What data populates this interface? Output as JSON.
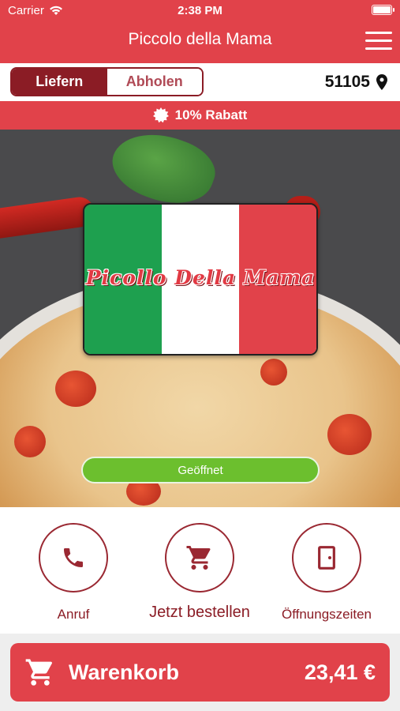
{
  "status_bar": {
    "carrier": "Carrier",
    "time": "2:38 PM"
  },
  "header": {
    "title": "Piccolo della Mama"
  },
  "mode": {
    "options": [
      "Liefern",
      "Abholen"
    ],
    "selected": "Liefern"
  },
  "location": {
    "zip": "51105"
  },
  "discount": {
    "label": "10% Rabatt"
  },
  "restaurant": {
    "logo_text": "Picollo Della Mama",
    "status": "Geöffnet"
  },
  "actions": [
    {
      "label": "Anruf",
      "icon": "phone-icon"
    },
    {
      "label": "Jetzt bestellen",
      "icon": "cart-icon"
    },
    {
      "label": "Öffnungszeiten",
      "icon": "door-icon"
    }
  ],
  "cart": {
    "label": "Warenkorb",
    "total": "23,41 €"
  },
  "colors": {
    "primary": "#e1424a",
    "dark_red": "#8b1c25",
    "open_green": "#6cbf2e"
  }
}
